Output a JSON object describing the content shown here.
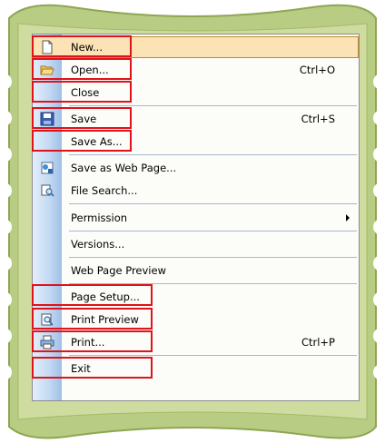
{
  "menu": {
    "items": [
      {
        "label": "New...",
        "shortcut": "",
        "icon": "new-document-icon"
      },
      {
        "label": "Open...",
        "shortcut": "Ctrl+O",
        "icon": "open-folder-icon"
      },
      {
        "label": "Close",
        "shortcut": "",
        "icon": ""
      },
      {
        "label": "Save",
        "shortcut": "Ctrl+S",
        "icon": "save-disk-icon"
      },
      {
        "label": "Save As...",
        "shortcut": "",
        "icon": ""
      },
      {
        "label": "Save as Web Page...",
        "shortcut": "",
        "icon": "web-page-icon"
      },
      {
        "label": "File Search...",
        "shortcut": "",
        "icon": "file-search-icon"
      },
      {
        "label": "Permission",
        "shortcut": "",
        "icon": "",
        "submenu": true
      },
      {
        "label": "Versions...",
        "shortcut": "",
        "icon": ""
      },
      {
        "label": "Web Page Preview",
        "shortcut": "",
        "icon": ""
      },
      {
        "label": "Page Setup...",
        "shortcut": "",
        "icon": ""
      },
      {
        "label": "Print Preview",
        "shortcut": "",
        "icon": "print-preview-icon"
      },
      {
        "label": "Print...",
        "shortcut": "Ctrl+P",
        "icon": "printer-icon"
      },
      {
        "label": "Exit",
        "shortcut": "",
        "icon": ""
      }
    ],
    "highlighted_item": "New..."
  },
  "colors": {
    "highlight_box": "#e0121a",
    "frame_green": "#b9cc83",
    "hover_fill": "#fbe3b5"
  }
}
